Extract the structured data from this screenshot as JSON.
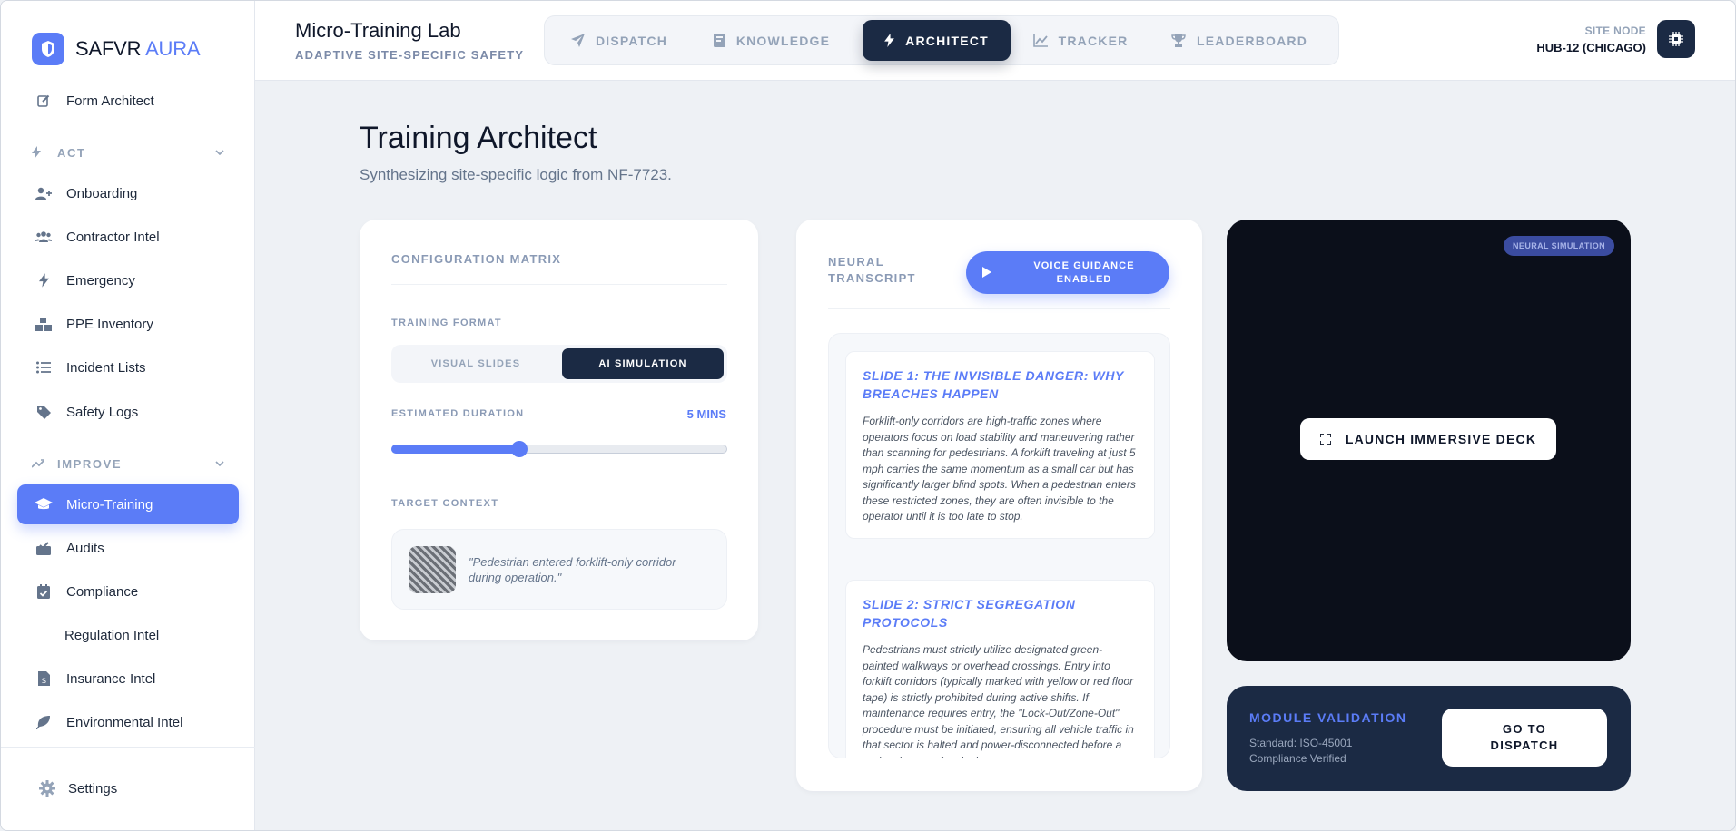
{
  "brand": {
    "name": "SAFVR",
    "accent": "AURA"
  },
  "sidebar": {
    "top_item": {
      "label": "Form Architect",
      "icon": "edit-icon"
    },
    "sections": [
      {
        "label": "ACT",
        "items": [
          {
            "label": "Onboarding",
            "icon": "user-plus-icon"
          },
          {
            "label": "Contractor Intel",
            "icon": "users-icon"
          },
          {
            "label": "Emergency",
            "icon": "bolt-icon"
          },
          {
            "label": "PPE Inventory",
            "icon": "boxes-icon"
          },
          {
            "label": "Incident Lists",
            "icon": "list-icon"
          },
          {
            "label": "Safety Logs",
            "icon": "tag-icon"
          }
        ]
      },
      {
        "label": "IMPROVE",
        "items": [
          {
            "label": "Micro-Training",
            "icon": "graduation-cap-icon",
            "active": true
          },
          {
            "label": "Audits",
            "icon": "inbox-check-icon"
          },
          {
            "label": "Compliance",
            "icon": "calendar-check-icon"
          },
          {
            "label": "Regulation Intel",
            "icon": ""
          },
          {
            "label": "Insurance Intel",
            "icon": "file-dollar-icon"
          },
          {
            "label": "Environmental Intel",
            "icon": "leaf-icon"
          }
        ]
      }
    ],
    "settings_label": "Settings"
  },
  "header": {
    "title": "Micro-Training Lab",
    "subtitle": "ADAPTIVE SITE-SPECIFIC SAFETY",
    "tabs": [
      {
        "label": "DISPATCH",
        "icon": "paper-plane-icon"
      },
      {
        "label": "KNOWLEDGE",
        "icon": "book-icon"
      },
      {
        "label": "ARCHITECT",
        "icon": "bolt-icon",
        "active": true
      },
      {
        "label": "TRACKER",
        "icon": "chart-line-icon"
      },
      {
        "label": "LEADERBOARD",
        "icon": "trophy-icon"
      }
    ],
    "site_node_label": "SITE NODE",
    "site_node_value": "HUB-12 (CHICAGO)"
  },
  "page": {
    "title": "Training Architect",
    "subtitle": "Synthesizing site-specific logic from NF-7723."
  },
  "config": {
    "title": "CONFIGURATION MATRIX",
    "format_label": "TRAINING FORMAT",
    "format_options": [
      "VISUAL SLIDES",
      "AI SIMULATION"
    ],
    "format_selected": "AI SIMULATION",
    "duration_label": "ESTIMATED DURATION",
    "duration_value": "5 MINS",
    "duration_fraction": 0.38,
    "context_label": "TARGET CONTEXT",
    "context_text": "\"Pedestrian entered forklift-only corridor during operation.\""
  },
  "transcript": {
    "title": "NEURAL TRANSCRIPT",
    "voice_button": "VOICE GUIDANCE ENABLED",
    "slides": [
      {
        "title": "SLIDE 1: THE INVISIBLE DANGER: WHY BREACHES HAPPEN",
        "body": "Forklift-only corridors are high-traffic zones where operators focus on load stability and maneuvering rather than scanning for pedestrians. A forklift traveling at just 5 mph carries the same momentum as a small car but has significantly larger blind spots. When a pedestrian enters these restricted zones, they are often invisible to the operator until it is too late to stop."
      },
      {
        "title": "SLIDE 2: STRICT SEGREGATION PROTOCOLS",
        "body": "Pedestrians must strictly utilize designated green-painted walkways or overhead crossings. Entry into forklift corridors (typically marked with yellow or red floor tape) is strictly prohibited during active shifts. If maintenance requires entry, the \"Lock-Out/Zone-Out\" procedure must be initiated, ensuring all vehicle traffic in that sector is halted and power-disconnected before a pedestrian sets foot in the zone."
      }
    ]
  },
  "simulation": {
    "badge": "NEURAL SIMULATION",
    "launch_label": "LAUNCH IMMERSIVE DECK"
  },
  "validation": {
    "title": "MODULE VALIDATION",
    "text": "Standard: ISO-45001 Compliance Verified",
    "button": "GO TO DISPATCH"
  },
  "colors": {
    "accent": "#5b7cf7",
    "navy": "#1b2a44",
    "sim_bg": "#0b0f1a"
  }
}
